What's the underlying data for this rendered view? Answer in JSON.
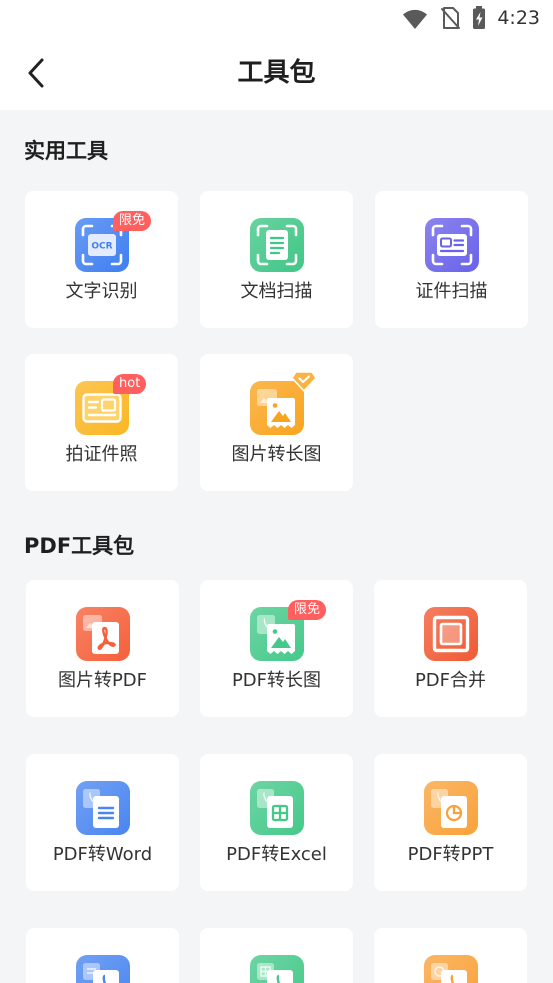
{
  "status_bar": {
    "time": "4:23",
    "icons": [
      "wifi-icon",
      "no-sim-icon",
      "battery-charging-icon"
    ]
  },
  "header": {
    "title": "工具包",
    "back_icon": "chevron-left-icon"
  },
  "colors": {
    "page_background": "#f4f5f7",
    "card_background": "#ffffff",
    "badge_red": "#ff5f5f",
    "title_text": "#1f1f1f",
    "label_text": "#333333"
  },
  "sections": [
    {
      "title": "实用工具",
      "tools": [
        {
          "label": "文字识别",
          "icon": "ocr-icon",
          "icon_text": "OCR",
          "color": "#3f7ff2",
          "badge": "限免"
        },
        {
          "label": "文档扫描",
          "icon": "document-scan-icon",
          "color": "#40c686"
        },
        {
          "label": "证件扫描",
          "icon": "id-card-scan-icon",
          "color": "#6a62ea"
        },
        {
          "label": "拍证件照",
          "icon": "id-photo-icon",
          "color": "#fbb623",
          "badge": "hot"
        },
        {
          "label": "图片转长图",
          "icon": "image-to-long-image-icon",
          "color": "#f9a41e",
          "badge_icon": "vip-diamond-icon"
        }
      ]
    },
    {
      "title": "PDF工具包",
      "tools": [
        {
          "label": "图片转PDF",
          "icon": "image-to-pdf-icon",
          "color": "#f5603a"
        },
        {
          "label": "PDF转长图",
          "icon": "pdf-to-long-image-icon",
          "color": "#45c98a",
          "badge": "限免"
        },
        {
          "label": "PDF合并",
          "icon": "pdf-merge-icon",
          "color": "#f15a34"
        },
        {
          "label": "PDF转Word",
          "icon": "pdf-to-word-icon",
          "color": "#4a86f0"
        },
        {
          "label": "PDF转Excel",
          "icon": "pdf-to-excel-icon",
          "color": "#45c98a"
        },
        {
          "label": "PDF转PPT",
          "icon": "pdf-to-ppt-icon",
          "color": "#f9a23a"
        },
        {
          "icon": "word-to-pdf-icon",
          "color": "#4a86f0"
        },
        {
          "icon": "excel-to-pdf-icon",
          "color": "#45c98a"
        },
        {
          "icon": "ppt-to-pdf-icon",
          "color": "#f9a23a"
        }
      ]
    }
  ]
}
